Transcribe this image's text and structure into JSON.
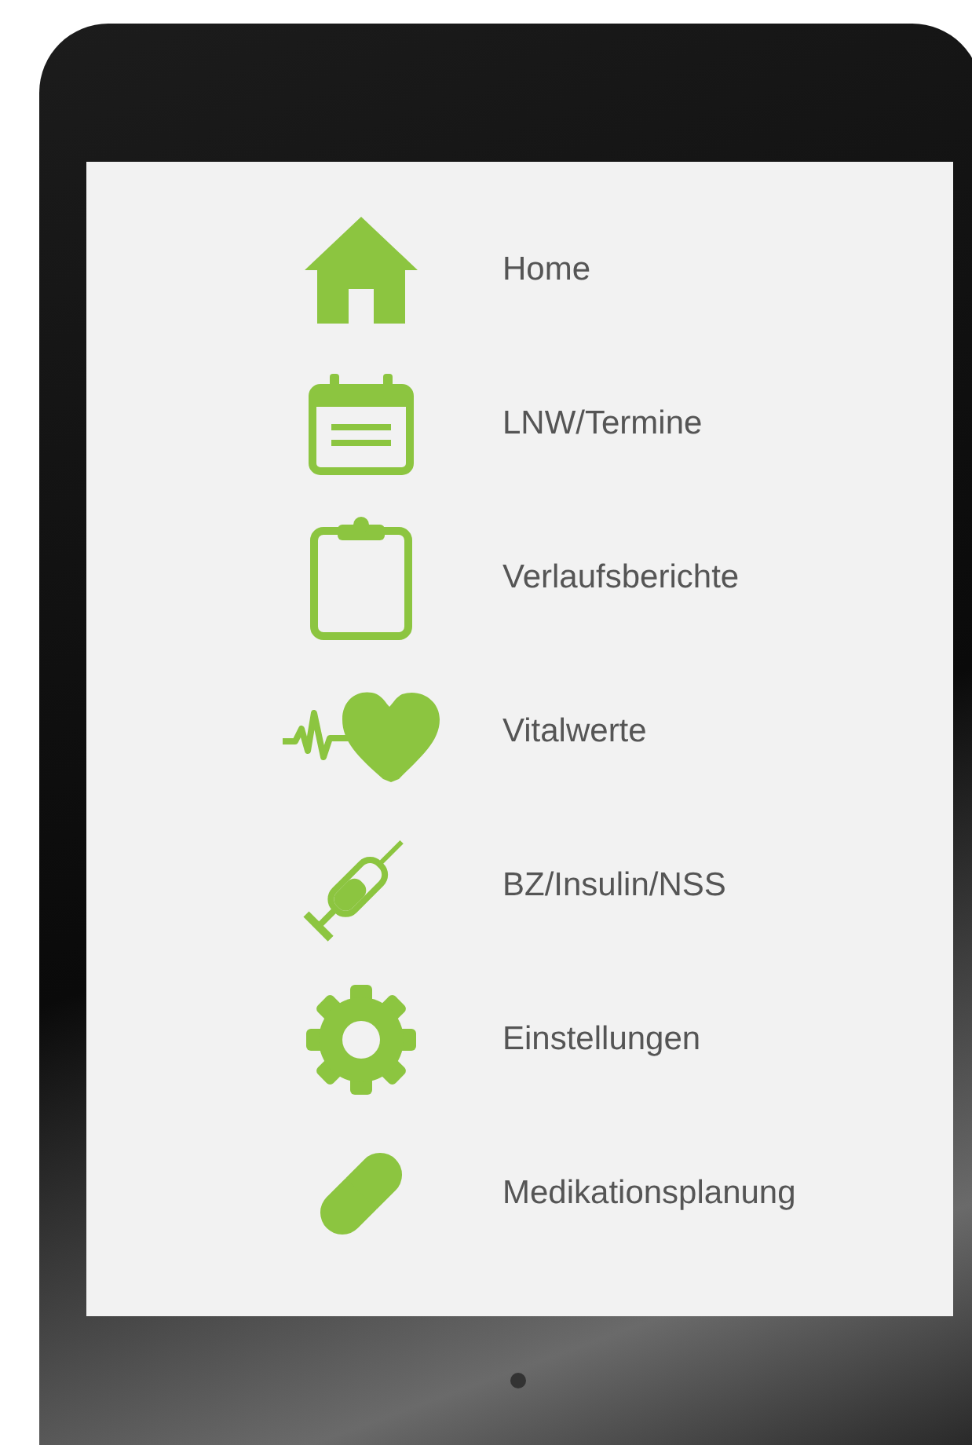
{
  "menu": [
    {
      "label": "Home",
      "kind": "home"
    },
    {
      "label": "LNW/Termine",
      "kind": "calendar"
    },
    {
      "label": "Verlaufsberichte",
      "kind": "clipboard"
    },
    {
      "label": "Vitalwerte",
      "kind": "heart"
    },
    {
      "label": "BZ/Insulin/NSS",
      "kind": "syringe"
    },
    {
      "label": "Einstellungen",
      "kind": "gear"
    },
    {
      "label": "Medikationsplanung",
      "kind": "pill"
    }
  ]
}
